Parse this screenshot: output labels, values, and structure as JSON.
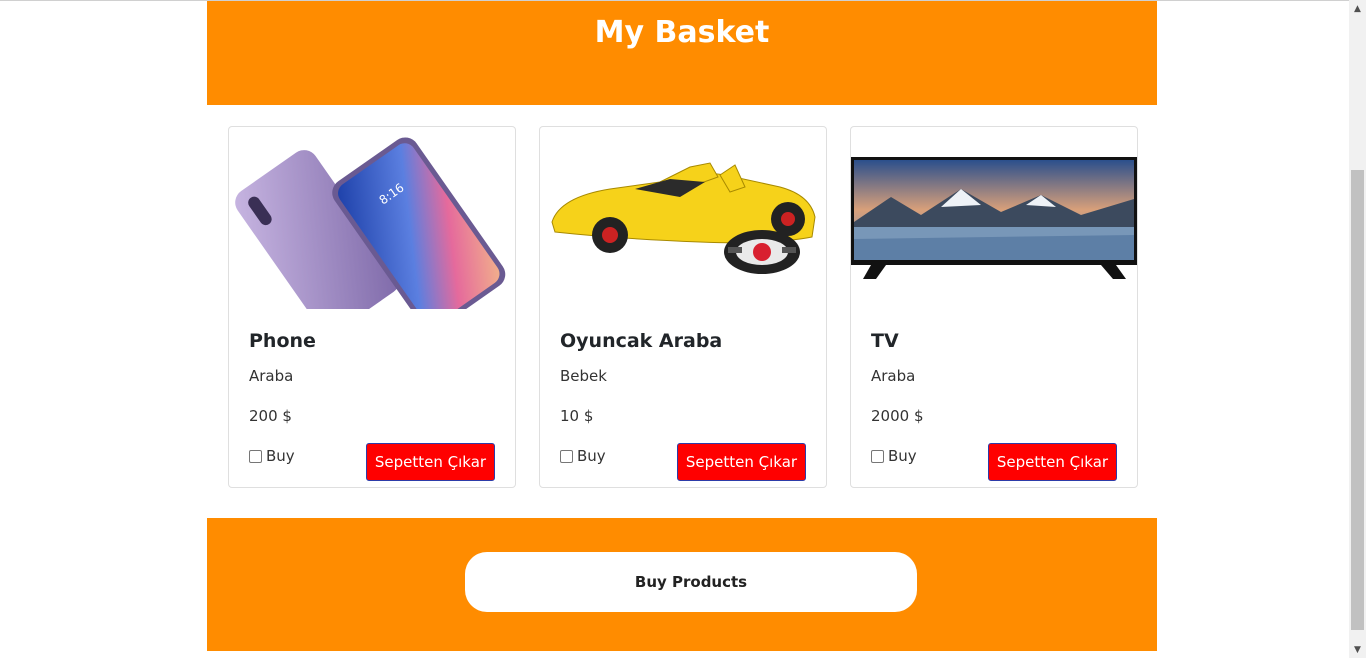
{
  "header": {
    "title": "My Basket"
  },
  "products": [
    {
      "name": "Phone",
      "category": "Araba",
      "price": "200 $",
      "buy_label": "Buy",
      "remove_label": "Sepetten Çıkar",
      "image_icon": "smartphone-image"
    },
    {
      "name": "Oyuncak Araba",
      "category": "Bebek",
      "price": "10 $",
      "buy_label": "Buy",
      "remove_label": "Sepetten Çıkar",
      "image_icon": "toy-car-image"
    },
    {
      "name": "TV",
      "category": "Araba",
      "price": "2000 $",
      "buy_label": "Buy",
      "remove_label": "Sepetten Çıkar",
      "image_icon": "television-image"
    }
  ],
  "footer": {
    "button_label": "Buy Products"
  },
  "colors": {
    "accent": "#ff8c00",
    "remove_button": "#ff0000"
  }
}
